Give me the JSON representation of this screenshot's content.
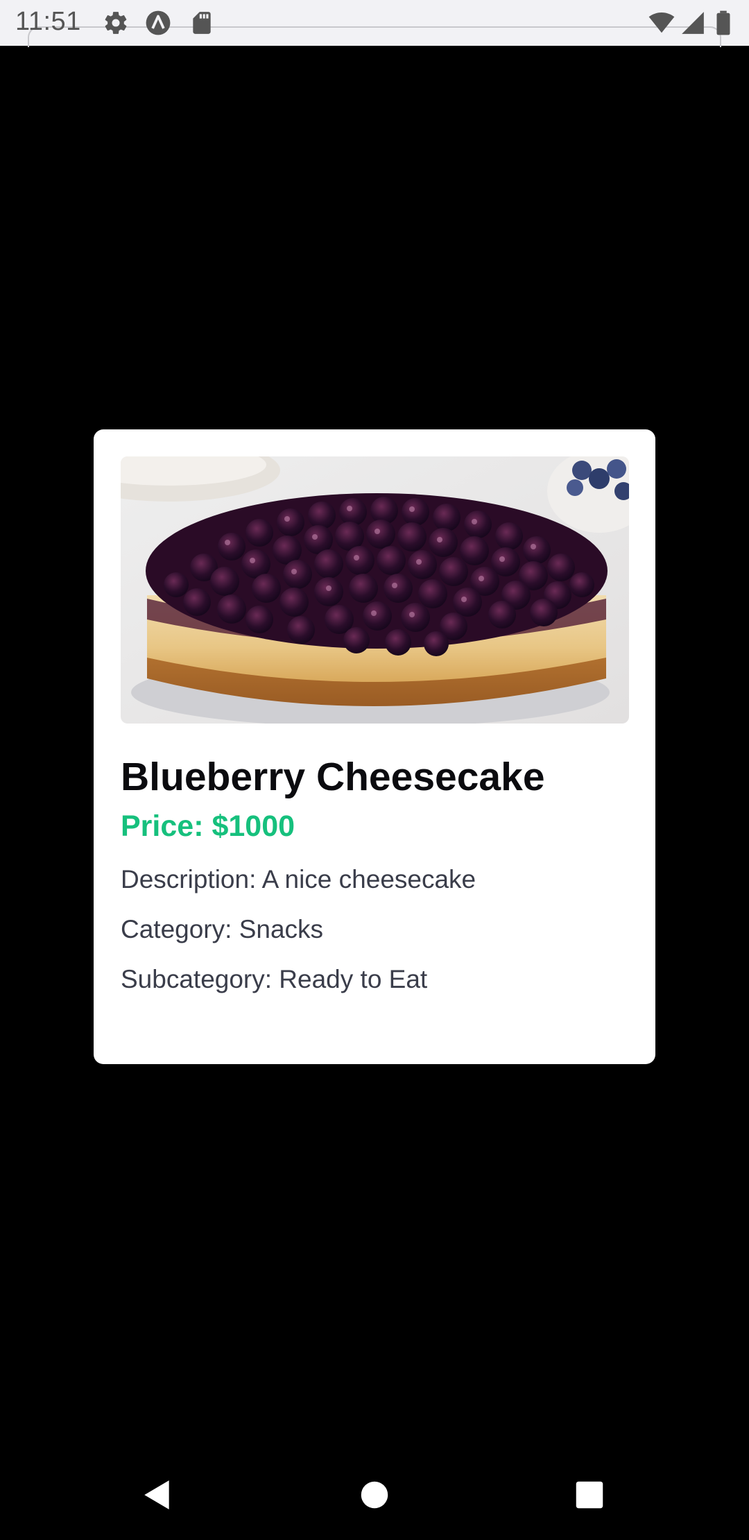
{
  "status_bar": {
    "time": "11:51",
    "icons_left": [
      "gear-icon",
      "app-a-icon",
      "sd-card-icon"
    ],
    "icons_right": [
      "wifi-icon",
      "signal-icon",
      "battery-icon"
    ]
  },
  "product": {
    "image_alt": "Blueberry cheesecake",
    "title": "Blueberry Cheesecake",
    "price": "Price: $1000",
    "description": "Description: A nice cheesecake",
    "category": "Category: Snacks",
    "subcategory": "Subcategory: Ready to Eat"
  },
  "colors": {
    "price": "#16c07d",
    "backdrop": "#000000",
    "card": "#ffffff"
  },
  "nav_bar": {
    "buttons": [
      "back-icon",
      "home-icon",
      "recents-icon"
    ]
  }
}
